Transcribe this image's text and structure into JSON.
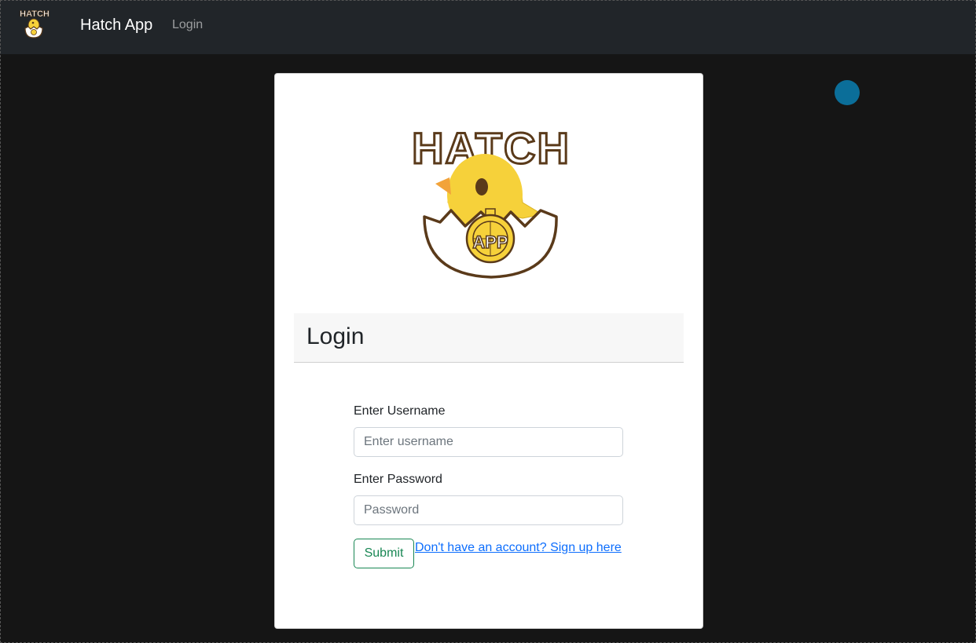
{
  "navbar": {
    "logo_text": "HATCH",
    "brand": "Hatch App",
    "links": [
      {
        "label": "Login"
      }
    ]
  },
  "card": {
    "logo": {
      "title_text": "HATCH",
      "badge_text": "APP"
    },
    "title": "Login",
    "form": {
      "username_label": "Enter Username",
      "username_placeholder": "Enter username",
      "username_value": "",
      "password_label": "Enter Password",
      "password_placeholder": "Password",
      "password_value": "",
      "submit_label": "Submit",
      "signup_link": "Don't have an account? Sign up here"
    }
  },
  "colors": {
    "page_background": "#151515",
    "navbar_background": "#212529",
    "accent_dot": "#0b6e99",
    "submit_green": "#198754",
    "link_blue": "#0d6efd",
    "chick_yellow": "#f6d13a",
    "outline_brown": "#5a3a1a"
  },
  "icons": {
    "nav_logo": "hatch-chick-logo-icon",
    "hero_logo": "hatch-chick-logo-icon",
    "indicator": "circle-indicator-icon"
  }
}
